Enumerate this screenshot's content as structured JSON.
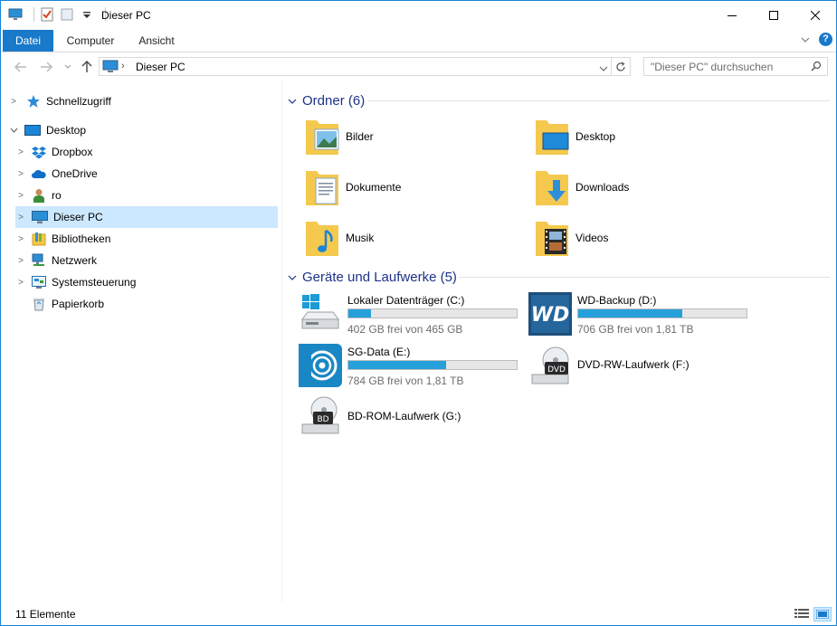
{
  "window": {
    "title": "Dieser PC",
    "accent": "#1979ca"
  },
  "ribbon": {
    "tabs": [
      {
        "label": "Datei"
      },
      {
        "label": "Computer"
      },
      {
        "label": "Ansicht"
      }
    ],
    "help": "?"
  },
  "address": {
    "location": "Dieser PC"
  },
  "search": {
    "placeholder": "\"Dieser PC\" durchsuchen"
  },
  "nav": {
    "items": [
      {
        "label": "Schnellzugriff",
        "icon": "star-icon"
      },
      {
        "label": "Desktop",
        "icon": "desktop-icon"
      },
      {
        "label": "Dropbox",
        "icon": "dropbox-icon"
      },
      {
        "label": "OneDrive",
        "icon": "onedrive-icon"
      },
      {
        "label": "ro",
        "icon": "user-icon"
      },
      {
        "label": "Dieser PC",
        "icon": "computer-icon",
        "selected": true
      },
      {
        "label": "Bibliotheken",
        "icon": "libraries-icon"
      },
      {
        "label": "Netzwerk",
        "icon": "network-icon"
      },
      {
        "label": "Systemsteuerung",
        "icon": "control-panel-icon"
      },
      {
        "label": "Papierkorb",
        "icon": "recycle-bin-icon"
      }
    ]
  },
  "folders": {
    "header": "Ordner (6)",
    "items": [
      {
        "label": "Bilder",
        "icon": "pictures-folder-icon"
      },
      {
        "label": "Desktop",
        "icon": "desktop-folder-icon"
      },
      {
        "label": "Dokumente",
        "icon": "documents-folder-icon"
      },
      {
        "label": "Downloads",
        "icon": "downloads-folder-icon"
      },
      {
        "label": "Musik",
        "icon": "music-folder-icon"
      },
      {
        "label": "Videos",
        "icon": "videos-folder-icon"
      }
    ]
  },
  "drives": {
    "header": "Geräte und Laufwerke (5)",
    "items": [
      {
        "name": "Lokaler Datenträger (C:)",
        "free": "402 GB frei von 465 GB",
        "used_fraction": 0.135,
        "icon": "windows-drive-icon"
      },
      {
        "name": "WD-Backup (D:)",
        "free": "706 GB frei von 1,81 TB",
        "used_fraction": 0.62,
        "icon": "wd-drive-icon"
      },
      {
        "name": "SG-Data (E:)",
        "free": "784 GB frei von 1,81 TB",
        "used_fraction": 0.58,
        "icon": "seagate-drive-icon"
      },
      {
        "name": "DVD-RW-Laufwerk (F:)",
        "icon": "dvd-drive-icon",
        "badge": "DVD"
      },
      {
        "name": "BD-ROM-Laufwerk (G:)",
        "icon": "bd-drive-icon",
        "badge": "BD"
      }
    ]
  },
  "status": {
    "count": "11 Elemente"
  }
}
